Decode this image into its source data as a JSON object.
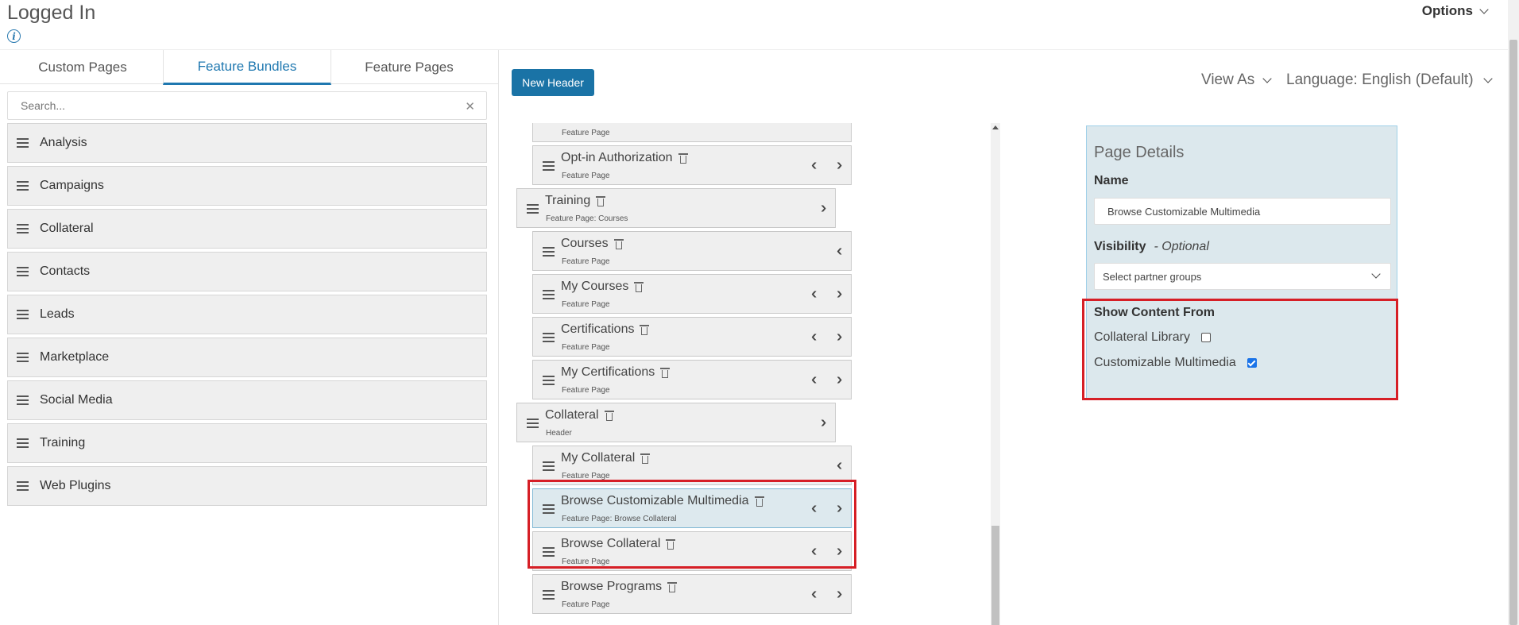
{
  "header": {
    "title": "Logged In",
    "info_icon": "info-icon",
    "options_label": "Options"
  },
  "tabs": [
    {
      "label": "Custom Pages",
      "active": false
    },
    {
      "label": "Feature Bundles",
      "active": true
    },
    {
      "label": "Feature Pages",
      "active": false
    }
  ],
  "search": {
    "placeholder": "Search...",
    "value": ""
  },
  "bundles": [
    "Analysis",
    "Campaigns",
    "Collateral",
    "Contacts",
    "Leads",
    "Marketplace",
    "Social Media",
    "Training",
    "Web Plugins"
  ],
  "toolbar": {
    "new_header_label": "New Header",
    "view_as_label": "View As",
    "language_label": "Language: English (Default)"
  },
  "tree": {
    "nodes": [
      {
        "title": "",
        "sub": "Feature Page"
      },
      {
        "title": "Opt-in Authorization",
        "sub": "Feature Page"
      },
      {
        "title": "Training",
        "sub": "Feature Page: Courses"
      },
      {
        "title": "Courses",
        "sub": "Feature Page"
      },
      {
        "title": "My Courses",
        "sub": "Feature Page"
      },
      {
        "title": "Certifications",
        "sub": "Feature Page"
      },
      {
        "title": "My Certifications",
        "sub": "Feature Page"
      },
      {
        "title": "Collateral",
        "sub": "Header"
      },
      {
        "title": "My Collateral",
        "sub": "Feature Page"
      },
      {
        "title": "Browse Customizable Multimedia",
        "sub": "Feature Page: Browse Collateral"
      },
      {
        "title": "Browse Collateral",
        "sub": "Feature Page"
      },
      {
        "title": "Browse Programs",
        "sub": "Feature Page"
      }
    ]
  },
  "details": {
    "title": "Page Details",
    "name_label": "Name",
    "name_value": "Browse Customizable Multimedia",
    "visibility_label": "Visibility",
    "visibility_optional": "- Optional",
    "partner_select_value": "Select partner groups",
    "show_content_label": "Show Content From",
    "sources": [
      {
        "label": "Collateral Library",
        "checked": false
      },
      {
        "label": "Customizable Multimedia",
        "checked": true
      }
    ]
  },
  "colors": {
    "accent": "#1f78b0",
    "button": "#1a73a6",
    "highlight": "#d61f26",
    "panel": "#dce8ed"
  }
}
